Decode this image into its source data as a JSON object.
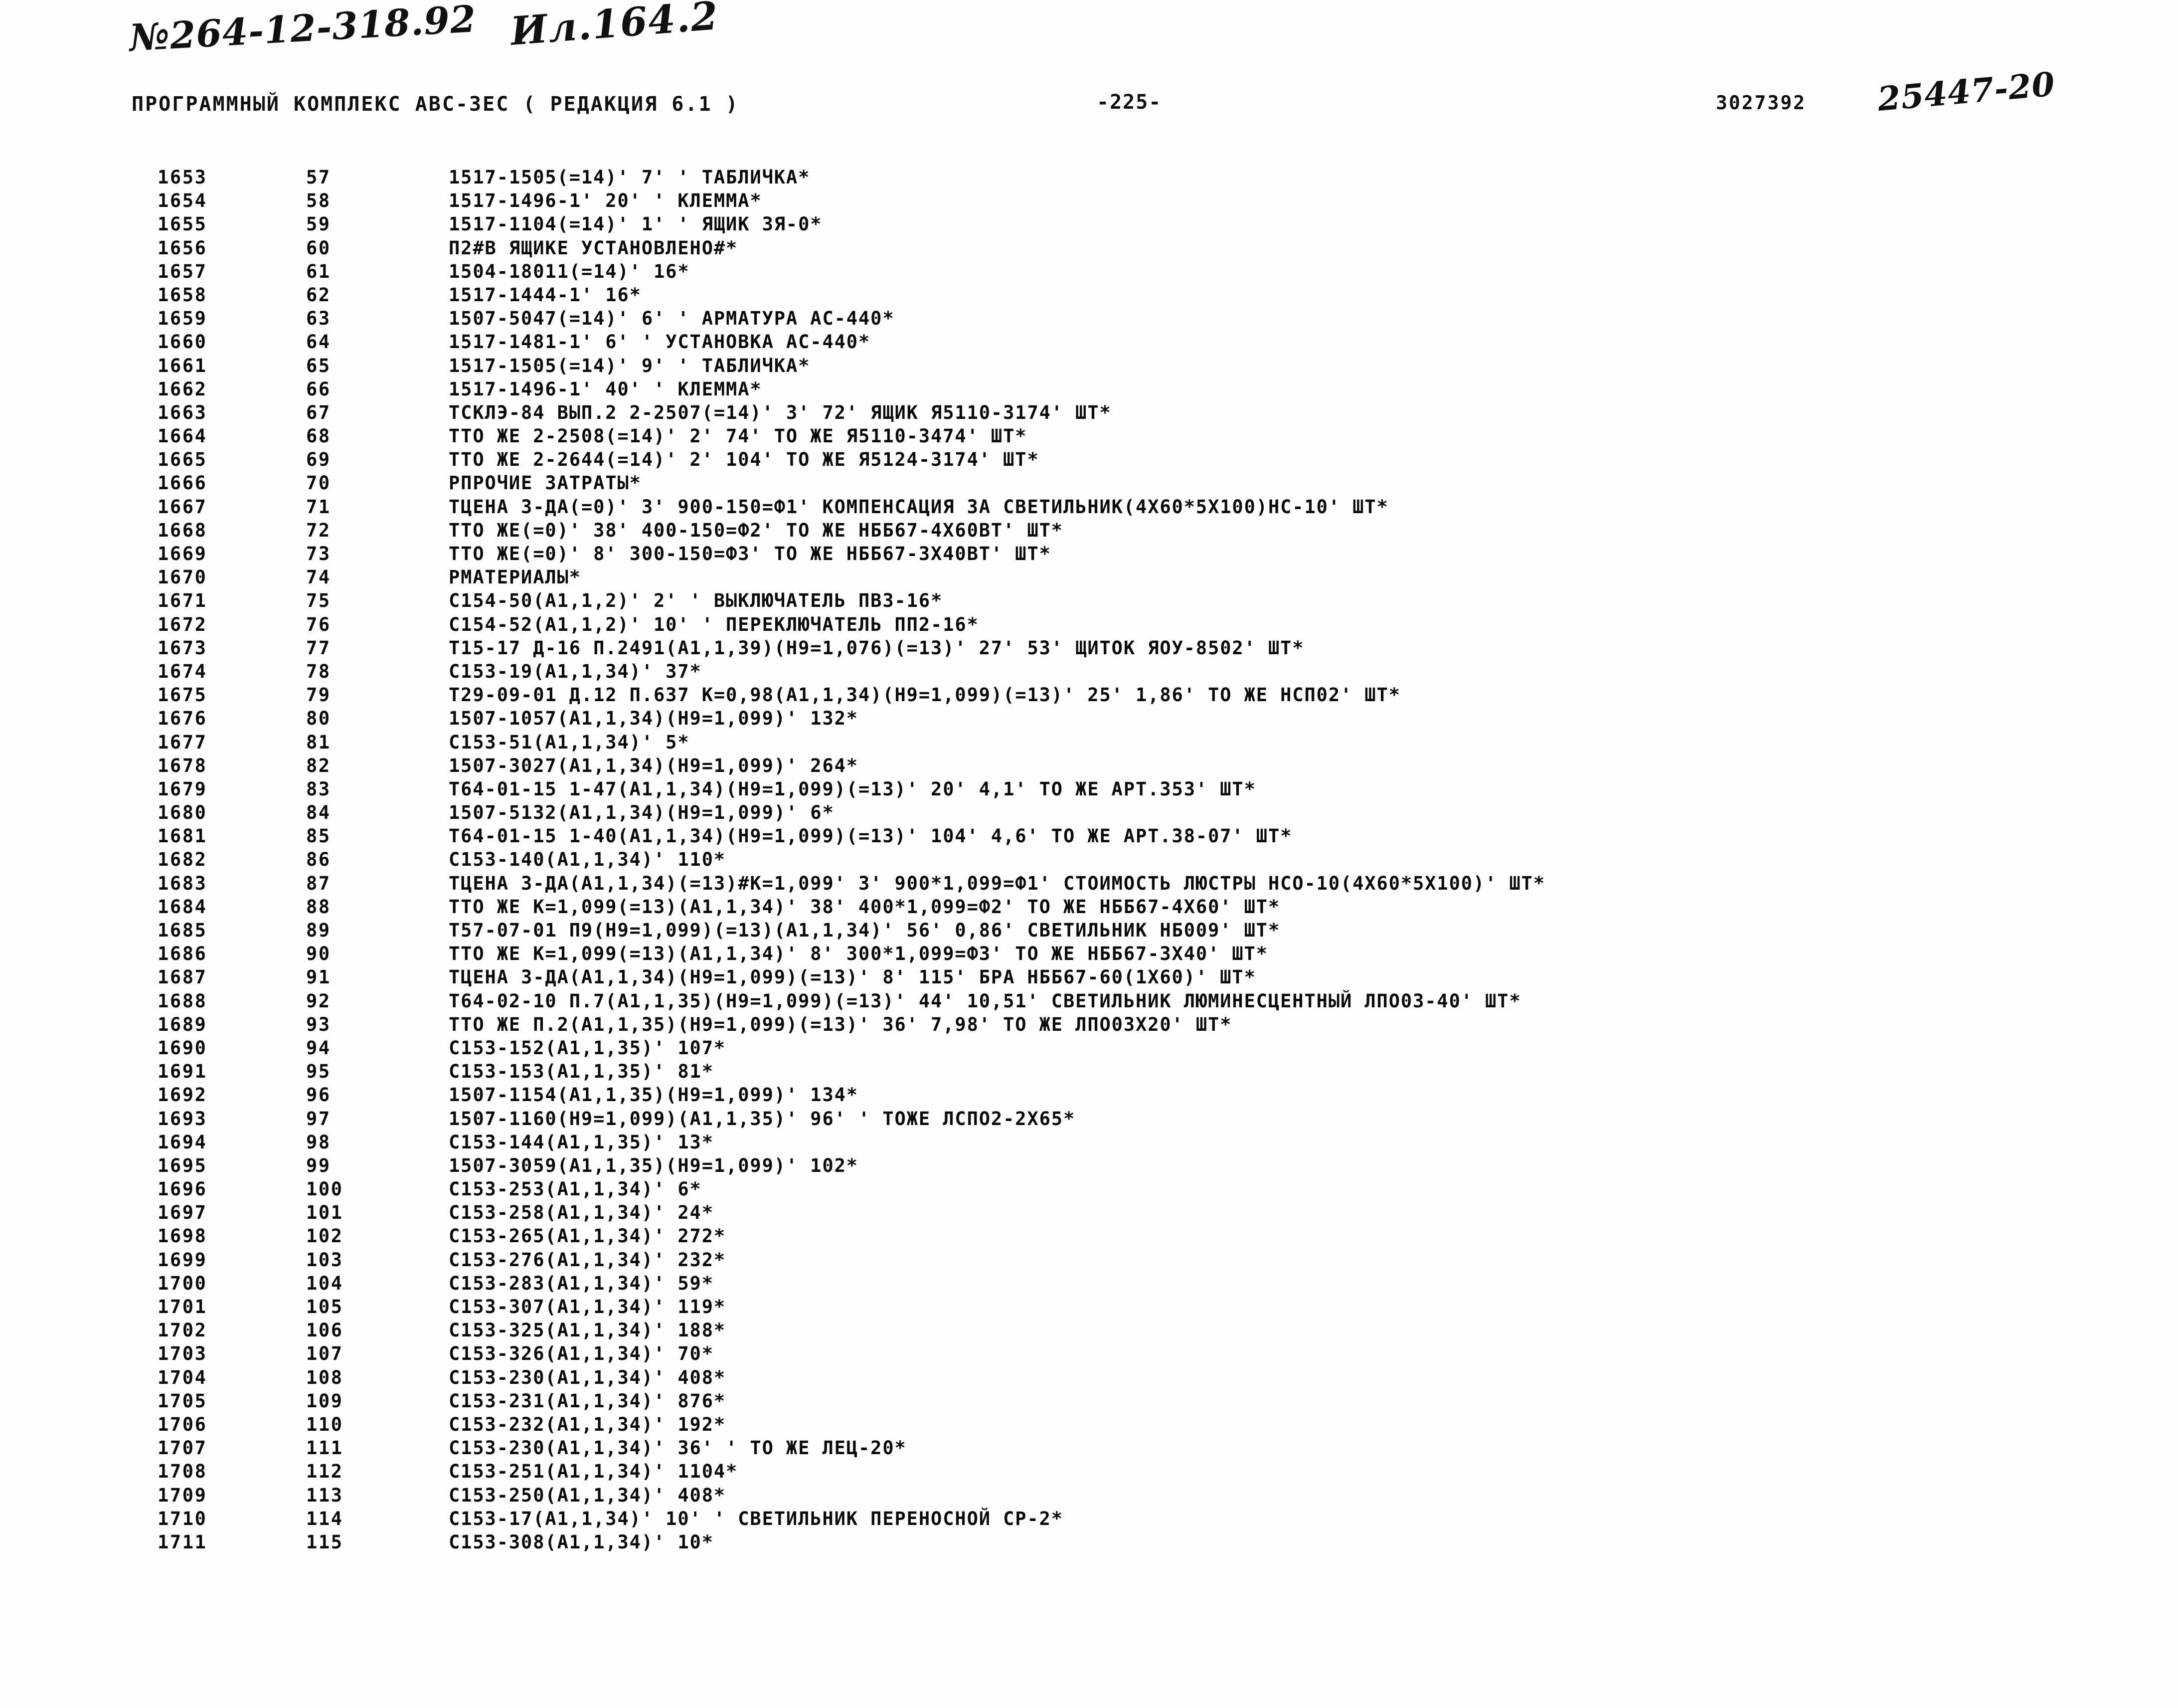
{
  "handwritten": {
    "doc_number": "№264-12-318.92",
    "sheet_number": "Ил.164.2",
    "archive_number": "25447-20"
  },
  "header": {
    "title": "ПРОГРАММНЫЙ КОМПЛЕКС АВС-ЗЕС    ( РЕДАКЦИЯ  6.1 )",
    "page_number": "-225-",
    "stamp_number": "3027392"
  },
  "listing": {
    "columns": [
      "line_no",
      "seq_no",
      "code"
    ],
    "rows": [
      {
        "line_no": "1653",
        "seq_no": "57",
        "code": "1517-1505(=14)' 7' ' ТАБЛИЧКА*"
      },
      {
        "line_no": "1654",
        "seq_no": "58",
        "code": "1517-1496-1' 20' ' КЛЕММА*"
      },
      {
        "line_no": "1655",
        "seq_no": "59",
        "code": "1517-1104(=14)' 1' ' ЯЩИК ЗЯ-0*"
      },
      {
        "line_no": "1656",
        "seq_no": "60",
        "code": "П2#В ЯЩИКЕ УСТАНОВЛЕНО#*"
      },
      {
        "line_no": "1657",
        "seq_no": "61",
        "code": "1504-18011(=14)' 16*"
      },
      {
        "line_no": "1658",
        "seq_no": "62",
        "code": "1517-1444-1' 16*"
      },
      {
        "line_no": "1659",
        "seq_no": "63",
        "code": "1507-5047(=14)' 6' ' АРМАТУРА АС-440*"
      },
      {
        "line_no": "1660",
        "seq_no": "64",
        "code": "1517-1481-1' 6' ' УСТАНОВКА АС-440*"
      },
      {
        "line_no": "1661",
        "seq_no": "65",
        "code": "1517-1505(=14)' 9' ' ТАБЛИЧКА*"
      },
      {
        "line_no": "1662",
        "seq_no": "66",
        "code": "1517-1496-1' 40' ' КЛЕММА*"
      },
      {
        "line_no": "1663",
        "seq_no": "67",
        "code": "ТСКЛЭ-84 ВЫП.2 2-2507(=14)' 3' 72' ЯЩИК Я5110-3174' ШТ*"
      },
      {
        "line_no": "1664",
        "seq_no": "68",
        "code": "ТТО ЖЕ 2-2508(=14)' 2' 74' ТО ЖЕ Я5110-3474' ШТ*"
      },
      {
        "line_no": "1665",
        "seq_no": "69",
        "code": "ТТО ЖЕ 2-2644(=14)' 2' 104' ТО ЖЕ Я5124-3174' ШТ*"
      },
      {
        "line_no": "1666",
        "seq_no": "70",
        "code": "РПРОЧИЕ ЗАТРАТЫ*"
      },
      {
        "line_no": "1667",
        "seq_no": "71",
        "code": "ТЦЕНА З-ДА(=0)' 3' 900-150=Ф1' КОМПЕНСАЦИЯ ЗА СВЕТИЛЬНИК(4Х60*5Х100)НС-10' ШТ*"
      },
      {
        "line_no": "1668",
        "seq_no": "72",
        "code": "ТТО ЖЕ(=0)' 38' 400-150=Ф2' ТО ЖЕ НББ67-4Х60ВТ' ШТ*"
      },
      {
        "line_no": "1669",
        "seq_no": "73",
        "code": "ТТО ЖЕ(=0)' 8' 300-150=Ф3' ТО ЖЕ НББ67-3Х40ВТ' ШТ*"
      },
      {
        "line_no": "1670",
        "seq_no": "74",
        "code": "РМАТЕРИАЛЫ*"
      },
      {
        "line_no": "1671",
        "seq_no": "75",
        "code": "С154-50(А1,1,2)' 2' ' ВЫКЛЮЧАТЕЛЬ ПВЗ-16*"
      },
      {
        "line_no": "1672",
        "seq_no": "76",
        "code": "С154-52(А1,1,2)' 10' ' ПЕРЕКЛЮЧАТЕЛЬ ПП2-16*"
      },
      {
        "line_no": "1673",
        "seq_no": "77",
        "code": "Т15-17 Д-16 П.2491(А1,1,39)(Н9=1,076)(=13)' 27' 53' ЩИТОК ЯОУ-8502' ШТ*"
      },
      {
        "line_no": "1674",
        "seq_no": "78",
        "code": "С153-19(А1,1,34)' 37*"
      },
      {
        "line_no": "1675",
        "seq_no": "79",
        "code": "Т29-09-01 Д.12 П.637 К=0,98(А1,1,34)(Н9=1,099)(=13)' 25' 1,86' ТО ЖЕ НСП02' ШТ*"
      },
      {
        "line_no": "1676",
        "seq_no": "80",
        "code": "1507-1057(А1,1,34)(Н9=1,099)' 132*"
      },
      {
        "line_no": "1677",
        "seq_no": "81",
        "code": "С153-51(А1,1,34)' 5*"
      },
      {
        "line_no": "1678",
        "seq_no": "82",
        "code": "1507-3027(А1,1,34)(Н9=1,099)' 264*"
      },
      {
        "line_no": "1679",
        "seq_no": "83",
        "code": "Т64-01-15 1-47(А1,1,34)(Н9=1,099)(=13)' 20' 4,1' ТО ЖЕ АРТ.353' ШТ*"
      },
      {
        "line_no": "1680",
        "seq_no": "84",
        "code": "1507-5132(А1,1,34)(Н9=1,099)' 6*"
      },
      {
        "line_no": "1681",
        "seq_no": "85",
        "code": "Т64-01-15 1-40(А1,1,34)(Н9=1,099)(=13)' 104' 4,6' ТО ЖЕ АРТ.38-07' ШТ*"
      },
      {
        "line_no": "1682",
        "seq_no": "86",
        "code": "С153-140(А1,1,34)' 110*"
      },
      {
        "line_no": "1683",
        "seq_no": "87",
        "code": "ТЦЕНА З-ДА(А1,1,34)(=13)#К=1,099' 3' 900*1,099=Ф1' СТОИМОСТЬ ЛЮСТРЫ НСО-10(4Х60*5Х100)' ШТ*"
      },
      {
        "line_no": "1684",
        "seq_no": "88",
        "code": "ТТО ЖЕ К=1,099(=13)(А1,1,34)' 38' 400*1,099=Ф2' ТО ЖЕ НББ67-4Х60' ШТ*"
      },
      {
        "line_no": "1685",
        "seq_no": "89",
        "code": "Т57-07-01 П9(Н9=1,099)(=13)(А1,1,34)' 56' 0,86' СВЕТИЛЬНИК НБ009' ШТ*"
      },
      {
        "line_no": "1686",
        "seq_no": "90",
        "code": "ТТО ЖЕ К=1,099(=13)(А1,1,34)' 8' 300*1,099=Ф3' ТО ЖЕ НББ67-3Х40' ШТ*"
      },
      {
        "line_no": "1687",
        "seq_no": "91",
        "code": "ТЦЕНА З-ДА(А1,1,34)(Н9=1,099)(=13)' 8' 115' БРА НББ67-60(1Х60)' ШТ*"
      },
      {
        "line_no": "1688",
        "seq_no": "92",
        "code": "Т64-02-10 П.7(А1,1,35)(Н9=1,099)(=13)' 44' 10,51' СВЕТИЛЬНИК ЛЮМИНЕСЦЕНТНЫЙ ЛПО03-40' ШТ*"
      },
      {
        "line_no": "1689",
        "seq_no": "93",
        "code": "ТТО ЖЕ П.2(А1,1,35)(Н9=1,099)(=13)' 36' 7,98' ТО ЖЕ ЛПО03Х20' ШТ*"
      },
      {
        "line_no": "1690",
        "seq_no": "94",
        "code": "С153-152(А1,1,35)' 107*"
      },
      {
        "line_no": "1691",
        "seq_no": "95",
        "code": "С153-153(А1,1,35)' 81*"
      },
      {
        "line_no": "1692",
        "seq_no": "96",
        "code": "1507-1154(А1,1,35)(Н9=1,099)' 134*"
      },
      {
        "line_no": "1693",
        "seq_no": "97",
        "code": "1507-1160(Н9=1,099)(А1,1,35)' 96' ' ТОЖЕ ЛСПО2-2Х65*"
      },
      {
        "line_no": "1694",
        "seq_no": "98",
        "code": "С153-144(А1,1,35)' 13*"
      },
      {
        "line_no": "1695",
        "seq_no": "99",
        "code": "1507-3059(А1,1,35)(Н9=1,099)' 102*"
      },
      {
        "line_no": "1696",
        "seq_no": "100",
        "code": "С153-253(А1,1,34)' 6*"
      },
      {
        "line_no": "1697",
        "seq_no": "101",
        "code": "С153-258(А1,1,34)' 24*"
      },
      {
        "line_no": "1698",
        "seq_no": "102",
        "code": "С153-265(А1,1,34)' 272*"
      },
      {
        "line_no": "1699",
        "seq_no": "103",
        "code": "С153-276(А1,1,34)' 232*"
      },
      {
        "line_no": "1700",
        "seq_no": "104",
        "code": "С153-283(А1,1,34)' 59*"
      },
      {
        "line_no": "1701",
        "seq_no": "105",
        "code": "С153-307(А1,1,34)' 119*"
      },
      {
        "line_no": "1702",
        "seq_no": "106",
        "code": "С153-325(А1,1,34)' 188*"
      },
      {
        "line_no": "1703",
        "seq_no": "107",
        "code": "С153-326(А1,1,34)' 70*"
      },
      {
        "line_no": "1704",
        "seq_no": "108",
        "code": "С153-230(А1,1,34)' 408*"
      },
      {
        "line_no": "1705",
        "seq_no": "109",
        "code": "С153-231(А1,1,34)' 876*"
      },
      {
        "line_no": "1706",
        "seq_no": "110",
        "code": "С153-232(А1,1,34)' 192*"
      },
      {
        "line_no": "1707",
        "seq_no": "111",
        "code": "С153-230(А1,1,34)' 36' ' ТО ЖЕ ЛЕЦ-20*"
      },
      {
        "line_no": "1708",
        "seq_no": "112",
        "code": "С153-251(А1,1,34)' 1104*"
      },
      {
        "line_no": "1709",
        "seq_no": "113",
        "code": "С153-250(А1,1,34)' 408*"
      },
      {
        "line_no": "1710",
        "seq_no": "114",
        "code": "С153-17(А1,1,34)' 10' ' СВЕТИЛЬНИК ПЕРЕНОСНОЙ СР-2*"
      },
      {
        "line_no": "1711",
        "seq_no": "115",
        "code": "С153-308(А1,1,34)' 10*"
      }
    ]
  }
}
